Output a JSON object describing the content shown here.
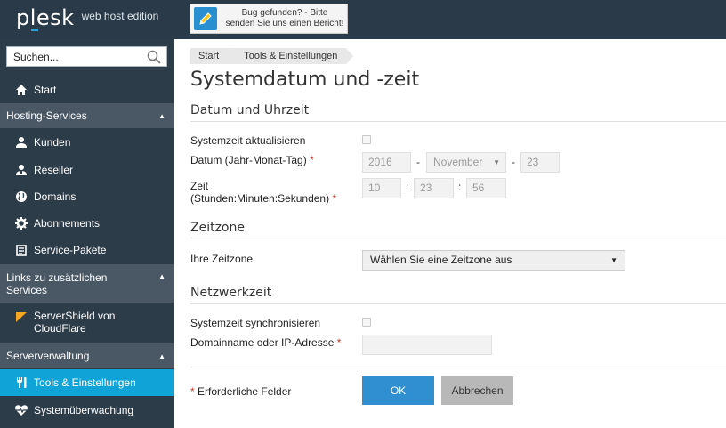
{
  "header": {
    "logo_main": "plesk",
    "logo_sub": "web host edition",
    "bug_report_line1": "Bug gefunden? - Bitte",
    "bug_report_line2": "senden Sie uns einen Bericht!"
  },
  "sidebar": {
    "search_placeholder": "Suchen...",
    "start": "Start",
    "groups": {
      "hosting": "Hosting-Services",
      "links_line1": "Links zu zusätzlichen",
      "links_line2": "Services",
      "server": "Serververwaltung"
    },
    "items": {
      "kunden": "Kunden",
      "reseller": "Reseller",
      "domains": "Domains",
      "abonnements": "Abonnements",
      "service_pakete": "Service-Pakete",
      "servershield_line1": "ServerShield von",
      "servershield_line2": "CloudFlare",
      "tools": "Tools & Einstellungen",
      "monitoring": "Systemüberwachung"
    },
    "active_color": "#0fa3d8"
  },
  "breadcrumb": [
    "Start",
    "Tools & Einstellungen"
  ],
  "page_title": "Systemdatum und -zeit",
  "sections": {
    "datetime": {
      "title": "Datum und Uhrzeit",
      "update_label": "Systemzeit aktualisieren",
      "date_label": "Datum (Jahr-Monat-Tag)",
      "year": "2016",
      "month": "November",
      "day": "23",
      "time_label_line1": "Zeit",
      "time_label_line2": "(Stunden:Minuten:Sekunden)",
      "hour": "10",
      "minute": "23",
      "second": "56",
      "dash": "-",
      "colon": ":"
    },
    "timezone": {
      "title": "Zeitzone",
      "label": "Ihre Zeitzone",
      "select_value": "Wählen Sie eine Zeitzone aus"
    },
    "network": {
      "title": "Netzwerkzeit",
      "sync_label": "Systemzeit synchronisieren",
      "domain_label": "Domainname oder IP-Adresse",
      "domain_value": ""
    }
  },
  "footer": {
    "required_note": "Erforderliche Felder",
    "required_mark": "*",
    "ok": "OK",
    "cancel": "Abbrechen"
  }
}
